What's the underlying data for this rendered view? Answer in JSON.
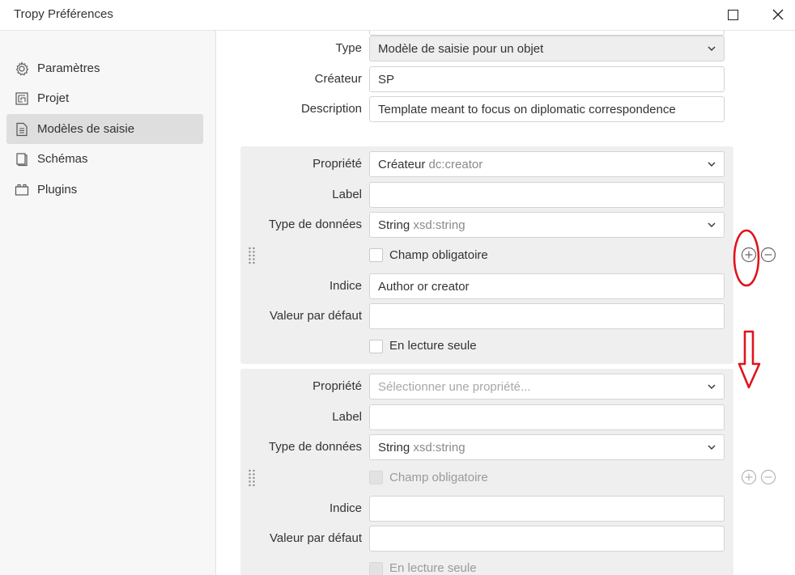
{
  "window": {
    "title": "Tropy Préférences"
  },
  "sidebar": {
    "items": [
      {
        "label": "Paramètres",
        "icon": "gear-icon",
        "active": false
      },
      {
        "label": "Projet",
        "icon": "project-icon",
        "active": false
      },
      {
        "label": "Modèles de saisie",
        "icon": "document-icon",
        "active": true
      },
      {
        "label": "Schémas",
        "icon": "copy-icon",
        "active": false
      },
      {
        "label": "Plugins",
        "icon": "plugin-icon",
        "active": false
      }
    ]
  },
  "template": {
    "type_label": "Type",
    "type_value": "Modèle de saisie pour un objet",
    "creator_label": "Créateur",
    "creator_value": "SP",
    "description_label": "Description",
    "description_value": "Template meant to focus on diplomatic correspondence"
  },
  "fields": [
    {
      "property_label": "Propriété",
      "property_value": "Créateur",
      "property_uri": "dc:creator",
      "label_label": "Label",
      "label_value": "",
      "datatype_label": "Type de données",
      "datatype_value": "String",
      "datatype_uri": "xsd:string",
      "required_label": "Champ obligatoire",
      "hint_label": "Indice",
      "hint_value": "Author or creator",
      "default_label": "Valeur par défaut",
      "default_value": "",
      "readonly_label": "En lecture seule"
    },
    {
      "property_label": "Propriété",
      "property_placeholder": "Sélectionner une propriété...",
      "label_label": "Label",
      "label_value": "",
      "datatype_label": "Type de données",
      "datatype_value": "String",
      "datatype_uri": "xsd:string",
      "required_label": "Champ obligatoire",
      "hint_label": "Indice",
      "hint_value": "",
      "default_label": "Valeur par défaut",
      "default_value": "",
      "readonly_label": "En lecture seule"
    }
  ],
  "colors": {
    "annotation_red": "#e0141e",
    "active_nav": "#dedede",
    "panel_bg": "#efefef"
  }
}
